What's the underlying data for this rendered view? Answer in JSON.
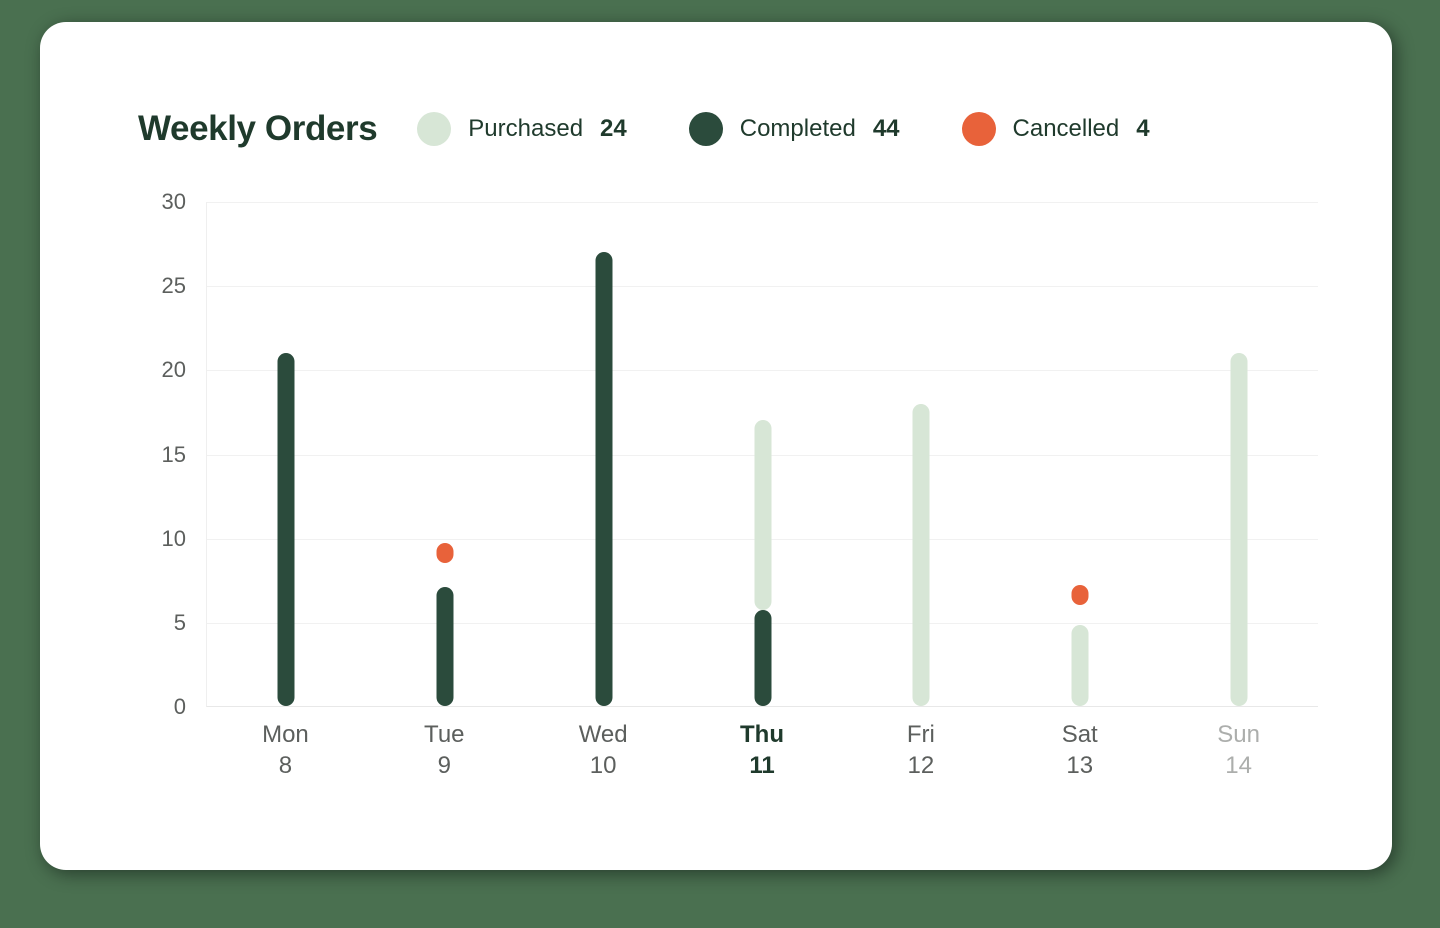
{
  "card": {
    "background_color": "#ffffff",
    "page_background_color": "#4a7050"
  },
  "header": {
    "title": "Weekly Orders"
  },
  "legend": {
    "items": [
      {
        "label": "Purchased",
        "value": "24",
        "color": "#d7e6d6",
        "swatch_name": "legend-swatch-purchased"
      },
      {
        "label": "Completed",
        "value": "44",
        "color": "#2b4b3c",
        "swatch_name": "legend-swatch-completed"
      },
      {
        "label": "Cancelled",
        "value": "4",
        "color": "#e8623a",
        "swatch_name": "legend-swatch-cancelled"
      }
    ]
  },
  "chart_data": {
    "type": "bar",
    "title": "Weekly Orders",
    "xlabel": "",
    "ylabel": "",
    "ylim": [
      0,
      30
    ],
    "yticks": [
      "0",
      "5",
      "10",
      "15",
      "20",
      "25",
      "30"
    ],
    "grid": true,
    "legend_position": "top-right",
    "stacked": true,
    "categories": [
      "Mon 8",
      "Tue 9",
      "Wed 10",
      "Thu 11",
      "Fri 12",
      "Sat 13",
      "Sun 14"
    ],
    "x_labels": [
      {
        "day": "Mon",
        "date": "8",
        "state": "normal"
      },
      {
        "day": "Tue",
        "date": "9",
        "state": "normal"
      },
      {
        "day": "Wed",
        "date": "10",
        "state": "normal"
      },
      {
        "day": "Thu",
        "date": "11",
        "state": "today"
      },
      {
        "day": "Fri",
        "date": "12",
        "state": "normal"
      },
      {
        "day": "Sat",
        "date": "13",
        "state": "normal"
      },
      {
        "day": "Sun",
        "date": "14",
        "state": "muted"
      }
    ],
    "series": [
      {
        "name": "Purchased",
        "color": "#d7e6d6",
        "values": [
          0,
          0,
          0,
          11.3,
          18,
          4.8,
          21
        ]
      },
      {
        "name": "Completed",
        "color": "#2b4b3c",
        "values": [
          21,
          7.1,
          27,
          5.7,
          0,
          0,
          0
        ]
      },
      {
        "name": "Cancelled",
        "color": "#e8623a",
        "values": [
          0,
          1.2,
          0,
          0,
          0,
          1.2,
          0
        ]
      }
    ],
    "segments": [
      {
        "category": "Mon 8",
        "bars": [
          {
            "series": "Completed",
            "from": 0,
            "to": 21,
            "color": "#2b4b3c"
          }
        ]
      },
      {
        "category": "Tue 9",
        "bars": [
          {
            "series": "Completed",
            "from": 0,
            "to": 7.1,
            "color": "#2b4b3c"
          },
          {
            "series": "Cancelled",
            "from": 8.5,
            "to": 9.7,
            "color": "#e8623a"
          }
        ]
      },
      {
        "category": "Wed 10",
        "bars": [
          {
            "series": "Completed",
            "from": 0,
            "to": 27,
            "color": "#2b4b3c"
          }
        ]
      },
      {
        "category": "Thu 11",
        "bars": [
          {
            "series": "Completed",
            "from": 0,
            "to": 5.7,
            "color": "#2b4b3c"
          },
          {
            "series": "Purchased",
            "from": 5.7,
            "to": 17,
            "color": "#d7e6d6"
          }
        ]
      },
      {
        "category": "Fri 12",
        "bars": [
          {
            "series": "Purchased",
            "from": 0,
            "to": 18,
            "color": "#d7e6d6"
          }
        ]
      },
      {
        "category": "Sat 13",
        "bars": [
          {
            "series": "Purchased",
            "from": 0,
            "to": 4.8,
            "color": "#d7e6d6"
          },
          {
            "series": "Cancelled",
            "from": 6.0,
            "to": 7.2,
            "color": "#e8623a"
          }
        ]
      },
      {
        "category": "Sun 14",
        "bars": [
          {
            "series": "Purchased",
            "from": 0,
            "to": 21,
            "color": "#d7e6d6"
          }
        ]
      }
    ]
  }
}
